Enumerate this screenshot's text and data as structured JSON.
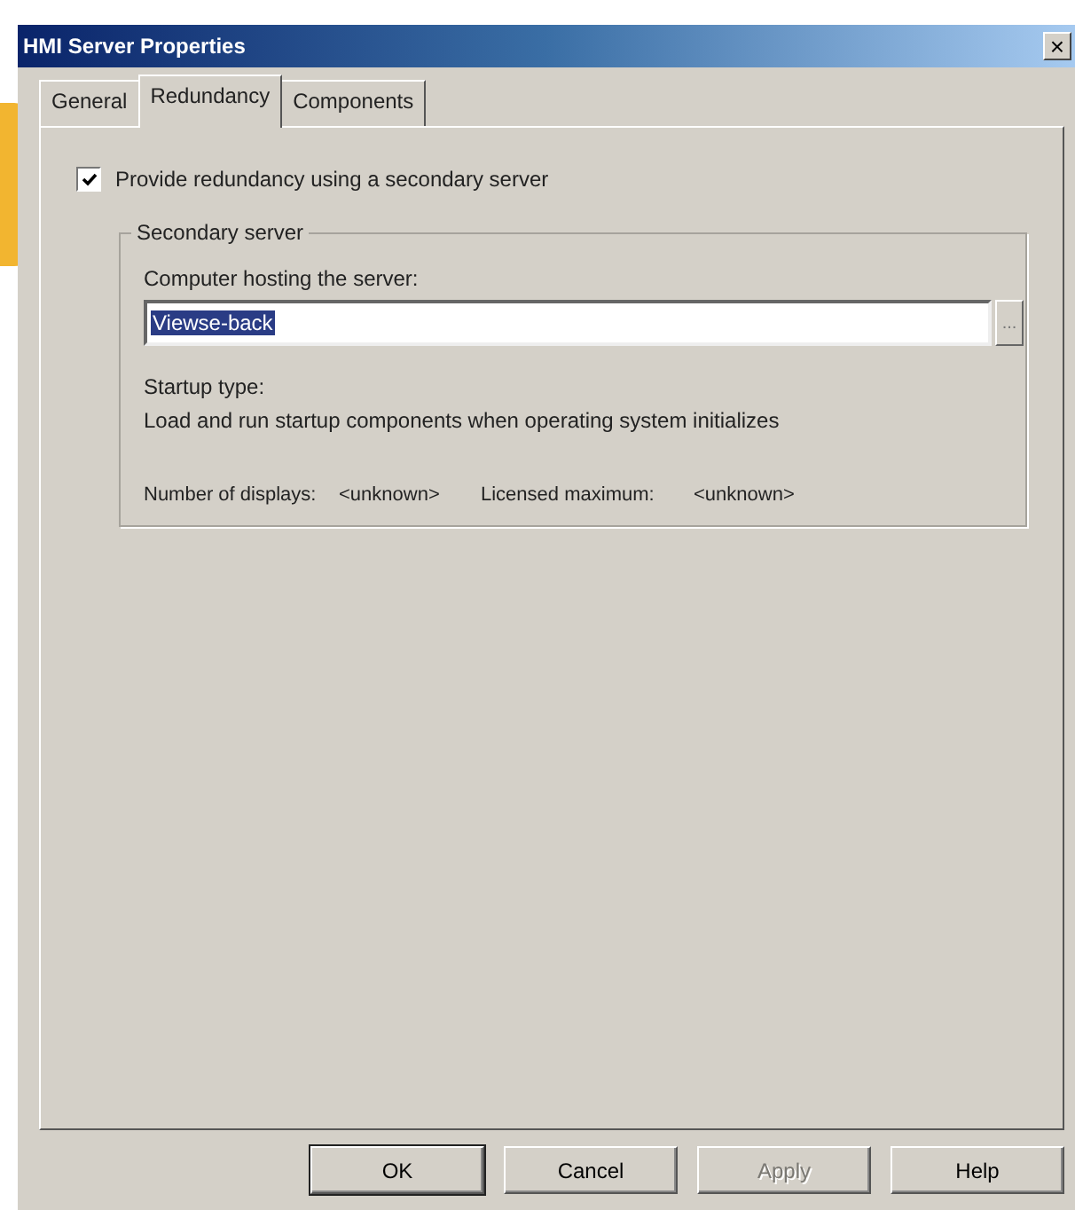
{
  "window": {
    "title": "HMI Server Properties",
    "close": "×"
  },
  "tabs": [
    {
      "label": "General",
      "selected": false
    },
    {
      "label": "Redundancy",
      "selected": true
    },
    {
      "label": "Components",
      "selected": false
    }
  ],
  "redundancy": {
    "label": "Provide redundancy using a secondary server",
    "checked": true
  },
  "group": {
    "title": "Secondary server",
    "computer_label": "Computer hosting the server:",
    "computer_value": "Viewse-back",
    "value_selected": true,
    "browse_button": "...",
    "startup_label": "Startup type:",
    "startup_value": "Load and run startup components when operating system initializes",
    "displays_label": "Number of displays:",
    "displays_value": "<unknown>",
    "licensed_label": "Licensed maximum:",
    "licensed_value": "<unknown>"
  },
  "buttons": [
    {
      "label": "OK",
      "default": true,
      "disabled": false
    },
    {
      "label": "Cancel",
      "default": false,
      "disabled": false
    },
    {
      "label": "Apply",
      "default": false,
      "disabled": true
    },
    {
      "label": "Help",
      "default": false,
      "disabled": false
    }
  ]
}
